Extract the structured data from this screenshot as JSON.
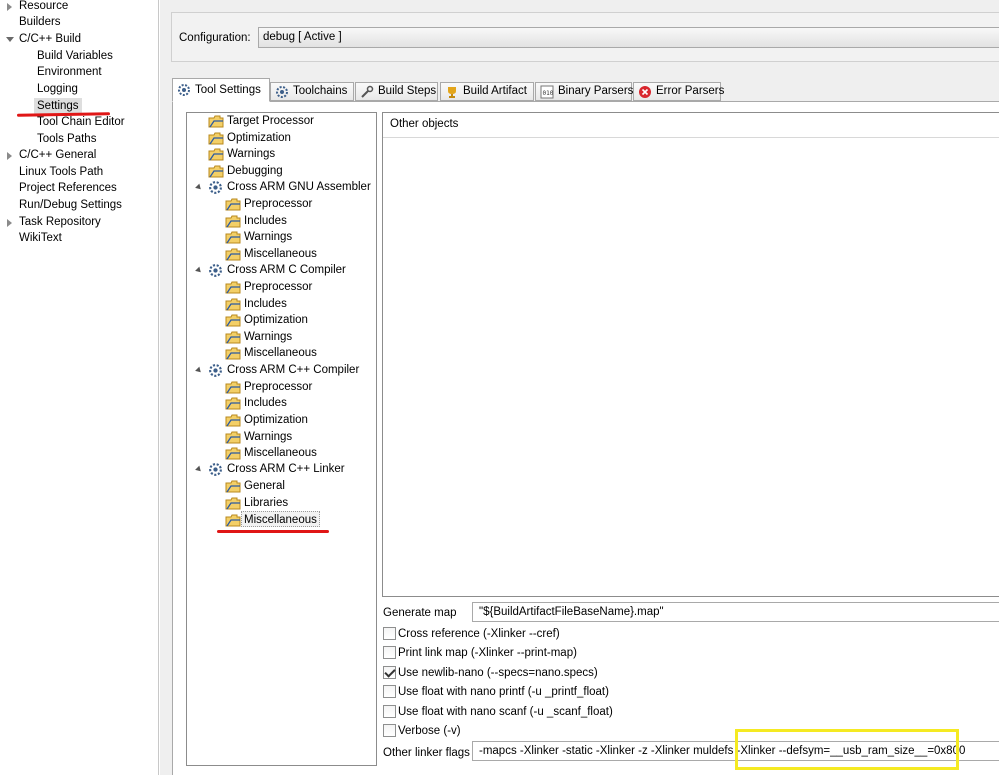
{
  "left_tree": {
    "items": [
      {
        "label": "Resource",
        "expand": "collapsed"
      },
      {
        "label": "Builders",
        "expand": "none"
      },
      {
        "label": "C/C++ Build",
        "expand": "expanded"
      },
      {
        "label": "Build Variables",
        "expand": "none"
      },
      {
        "label": "Environment",
        "expand": "none"
      },
      {
        "label": "Logging",
        "expand": "none"
      },
      {
        "label": "Settings",
        "expand": "none",
        "selected": true
      },
      {
        "label": "Tool Chain Editor",
        "expand": "none"
      },
      {
        "label": "Tools Paths",
        "expand": "none"
      },
      {
        "label": "C/C++ General",
        "expand": "collapsed"
      },
      {
        "label": "Linux Tools Path",
        "expand": "none"
      },
      {
        "label": "Project References",
        "expand": "none"
      },
      {
        "label": "Run/Debug Settings",
        "expand": "none"
      },
      {
        "label": "Task Repository",
        "expand": "collapsed"
      },
      {
        "label": "WikiText",
        "expand": "none"
      }
    ]
  },
  "configuration": {
    "label": "Configuration:",
    "value": "debug  [ Active ]"
  },
  "tabs": [
    {
      "label": "Tool Settings",
      "icon": "gear-icon",
      "active": true
    },
    {
      "label": "Toolchains",
      "icon": "gear-icon"
    },
    {
      "label": "Build Steps",
      "icon": "wrench-icon"
    },
    {
      "label": "Build Artifact",
      "icon": "trophy-icon"
    },
    {
      "label": "Binary Parsers",
      "icon": "binary-icon"
    },
    {
      "label": "Error Parsers",
      "icon": "error-icon"
    }
  ],
  "tool_tree": {
    "items": [
      {
        "label": "Target Processor",
        "kind": "option"
      },
      {
        "label": "Optimization",
        "kind": "option"
      },
      {
        "label": "Warnings",
        "kind": "option"
      },
      {
        "label": "Debugging",
        "kind": "option"
      },
      {
        "label": "Cross ARM GNU Assembler",
        "kind": "tool"
      },
      {
        "label": "Preprocessor",
        "kind": "option"
      },
      {
        "label": "Includes",
        "kind": "option"
      },
      {
        "label": "Warnings",
        "kind": "option"
      },
      {
        "label": "Miscellaneous",
        "kind": "option"
      },
      {
        "label": "Cross ARM C Compiler",
        "kind": "tool"
      },
      {
        "label": "Preprocessor",
        "kind": "option"
      },
      {
        "label": "Includes",
        "kind": "option"
      },
      {
        "label": "Optimization",
        "kind": "option"
      },
      {
        "label": "Warnings",
        "kind": "option"
      },
      {
        "label": "Miscellaneous",
        "kind": "option"
      },
      {
        "label": "Cross ARM C++ Compiler",
        "kind": "tool"
      },
      {
        "label": "Preprocessor",
        "kind": "option"
      },
      {
        "label": "Includes",
        "kind": "option"
      },
      {
        "label": "Optimization",
        "kind": "option"
      },
      {
        "label": "Warnings",
        "kind": "option"
      },
      {
        "label": "Miscellaneous",
        "kind": "option"
      },
      {
        "label": "Cross ARM C++ Linker",
        "kind": "tool"
      },
      {
        "label": "General",
        "kind": "option"
      },
      {
        "label": "Libraries",
        "kind": "option"
      },
      {
        "label": "Miscellaneous",
        "kind": "option",
        "selected": true
      }
    ]
  },
  "options_panel": {
    "objects_header": "Other objects",
    "generate_map_label": "Generate map",
    "generate_map_value": "\"${BuildArtifactFileBaseName}.map\"",
    "checkboxes": [
      {
        "label": "Cross reference (-Xlinker --cref)",
        "checked": false
      },
      {
        "label": "Print link map (-Xlinker --print-map)",
        "checked": false
      },
      {
        "label": "Use newlib-nano (--specs=nano.specs)",
        "checked": true
      },
      {
        "label": "Use float with nano printf (-u _printf_float)",
        "checked": false
      },
      {
        "label": "Use float with nano scanf (-u _scanf_float)",
        "checked": false
      },
      {
        "label": "Verbose (-v)",
        "checked": false
      }
    ],
    "other_flags_label": "Other linker flags",
    "other_flags_value": "-mapcs  -Xlinker -static  -Xlinker -z  -Xlinker muldefs -Xlinker --defsym=__usb_ram_size__=0x800"
  },
  "colors": {
    "annotation_red": "#e01616",
    "annotation_yellow": "#f5ea22"
  }
}
